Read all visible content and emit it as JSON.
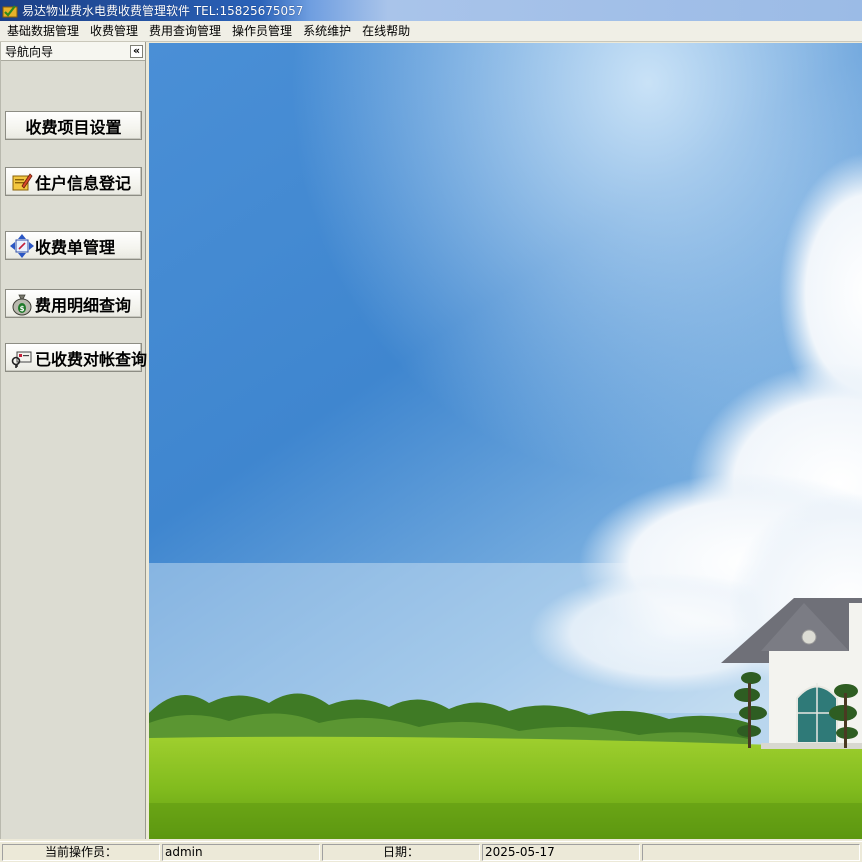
{
  "window": {
    "title": "易达物业费水电费收费管理软件    TEL:15825675057",
    "app_icon": "folder-check-icon"
  },
  "menubar": {
    "items": [
      "基础数据管理",
      "收费管理",
      "费用查询管理",
      "操作员管理",
      "系统维护",
      "在线帮助"
    ]
  },
  "nav": {
    "title": "导航向导",
    "collapse_symbol": "«",
    "buttons": [
      {
        "label": "收费项目设置",
        "icon": null
      },
      {
        "label": "住户信息登记",
        "icon": "edit-folder-icon"
      },
      {
        "label": "收费单管理",
        "icon": "bill-arrows-icon"
      },
      {
        "label": "费用明细查询",
        "icon": "money-bag-icon"
      },
      {
        "label": "已收费对帐查询",
        "icon": "key-card-icon"
      }
    ]
  },
  "main": {
    "background": "sky-grass-house-wallpaper"
  },
  "status": {
    "operator_label": "当前操作员：",
    "operator_value": "admin",
    "date_label": "日期：",
    "date_value": "2025-05-17"
  }
}
